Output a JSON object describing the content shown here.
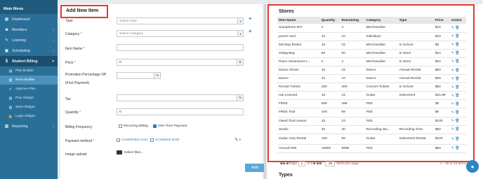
{
  "sidebar": {
    "title": "Main Menu",
    "items": [
      {
        "label": "Dashboard",
        "icon": "dashboard-icon",
        "glyph": "▦",
        "expandable": false
      },
      {
        "label": "Members",
        "icon": "members-icon",
        "glyph": "☻",
        "expandable": true
      },
      {
        "label": "Learning",
        "icon": "learning-icon",
        "glyph": "✎",
        "expandable": true
      },
      {
        "label": "Scheduling",
        "icon": "scheduling-icon",
        "glyph": "▣",
        "expandable": true
      },
      {
        "label": "Student Billing",
        "icon": "billing-icon",
        "glyph": "$",
        "expandable": true
      }
    ],
    "subitems": [
      {
        "label": "Plan Builder",
        "icon": "plan-builder-icon",
        "glyph": "▤"
      },
      {
        "label": "Store Builder",
        "icon": "store-builder-icon",
        "glyph": "▥"
      },
      {
        "label": "Approve Plan",
        "icon": "approve-plan-icon",
        "glyph": "✔"
      },
      {
        "label": "Plan Widget",
        "icon": "plan-widget-icon",
        "glyph": "▧"
      },
      {
        "label": "Store Widget",
        "icon": "store-widget-icon",
        "glyph": "▨"
      },
      {
        "label": "Login Widget",
        "icon": "login-widget-icon",
        "glyph": "🔒"
      }
    ],
    "reporting": {
      "label": "Reporting",
      "glyph": "▩"
    }
  },
  "form": {
    "title": "Add New Item",
    "type_label": "Type",
    "type_placeholder": "Select Type",
    "category_label": "Category",
    "category_placeholder": "Select Category",
    "item_name_label": "Item Name",
    "price_label": "Price",
    "price_value": "0",
    "price_suffix": "$",
    "promo_label": "Promotion Percentage Off",
    "promo_label2": "(First Payment)",
    "promo_suffix": "%",
    "tax_label": "Tax",
    "tax_suffix": "%",
    "quantity_label": "Quantity",
    "quantity_value": "0",
    "billing_label": "Billing Frequency",
    "billing_opt1": "Recurring Billing",
    "billing_opt2": "One-Time Payment",
    "payment_label": "Payment method",
    "payment_opt1": "Credit/Debit Card",
    "payment_opt2": "ACH/Bank Draft",
    "image_label": "Image upload",
    "image_button": "Select files...",
    "add_label": "Add",
    "required_mark": "*"
  },
  "stores": {
    "title": "Stores",
    "columns": [
      "Item Name",
      "Quantity",
      "Remaining",
      "Category",
      "Type",
      "Price",
      "Action"
    ],
    "rows": [
      [
        "Saxophone 007",
        "4",
        "4",
        "Merchandise",
        "",
        "$15"
      ],
      [
        "punch card",
        "10",
        "10",
        "Individual",
        "",
        "$15"
      ],
      [
        "Mel Bay Books",
        "15",
        "15",
        "Merchandise",
        "In School",
        "$0"
      ],
      [
        "SWag Bag",
        "50",
        "50",
        "Merchandise",
        "In Store",
        "$12"
      ],
      [
        "Piano Adventures L...",
        "2",
        "2",
        "Merchandise",
        "In Store",
        "$10"
      ],
      [
        "Dance Shoes",
        "15",
        "15",
        "Dance",
        "Annual Recital",
        "$50"
      ],
      [
        "Dance",
        "10",
        "10",
        "Dance",
        "Annual Recital",
        "$25"
      ],
      [
        "Recital Tickets",
        "200",
        "200",
        "Concert Tickets",
        "In School",
        "$50"
      ],
      [
        "Hal Leonard",
        "15",
        "15",
        "Guitar",
        "Instrument",
        "$15.99"
      ],
      [
        "FREE",
        "500",
        "496",
        "FEE",
        "",
        "$0"
      ],
      [
        "FREE Trial",
        "100",
        "98",
        "FEE",
        "",
        "$0"
      ],
      [
        "Owed Trial Lesson",
        "25",
        "24",
        "FEE",
        "",
        "$100"
      ],
      [
        "Studio",
        "30",
        "30",
        "Recording Stu...",
        "Recording Time",
        "$50"
      ],
      [
        "Guitar Amp Rental",
        "100",
        "98",
        "Guitar",
        "Instrument Rental",
        "$100"
      ],
      [
        "Annual FEE",
        "10000",
        "9998",
        "FEE",
        "",
        "$50"
      ]
    ],
    "pager": {
      "page_word": "Page",
      "page": "1",
      "of_text": "of 2",
      "per_page": "15",
      "per_page_label": "items per page",
      "range_text": "1 - 15 of 24 items"
    }
  },
  "types_title": "Types"
}
